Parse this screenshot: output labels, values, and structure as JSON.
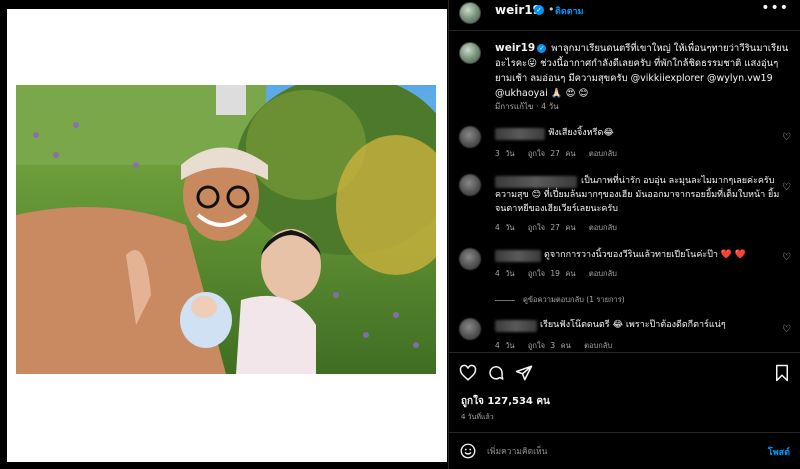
{
  "post": {
    "username": "weir19",
    "follow_label": "ติดตาม",
    "more_label": "•••",
    "verified_mark": "✓",
    "dot": "•"
  },
  "caption": {
    "username": "weir19",
    "text": "พาลูกมาเรียนดนตรีที่เขาใหญ่ ให้เพื่อนๆทายว่าวีรินมาเรียนอะไรคะ😜 ช่วงนี้อากาศกำลังดีเลยครับ ที่พักใกล้ชิดธรรมชาติ แสงอุ่นๆยามเช้า ลมอ่อนๆ มีความสุขครับ @vikkiiexplorer @wylyn.vw19 @ukhaoyai 🙏🏻 😍 😊",
    "meta": "มีการแก้ไข · 4 วัน"
  },
  "comments": [
    {
      "text": "ฟังเสียงจิ้งหรีด😂",
      "time": "3 วัน",
      "likes": "ถูกใจ 27 คน",
      "reply": "ตอบกลับ"
    },
    {
      "text": "เป็นภาพที่น่ารัก อบอุ่น ละมุนละไมมากๆเลยค่ะครับ ความสุข 😊 ที่เปี่ยมล้นมากๆของเฮีย มันออกมาจากรอยยิ้มที่เต็มใบหน้า ยิ้มจนตาหยีของเฮียเวียร์เลยนะครับ",
      "time": "4 วัน",
      "likes": "ถูกใจ 27 คน",
      "reply": "ตอบกลับ"
    },
    {
      "text": "ดูจากการวางนิ้วของวีรินแล้วทายเปียโนค่ะป๊า ❤️ ❤️",
      "time": "4 วัน",
      "likes": "ถูกใจ 19 คน",
      "reply": "ตอบกลับ",
      "view_replies": "ดูข้อความตอบกลับ (1 รายการ)"
    },
    {
      "text": "เรียนฟังโน๊ตดนตรี 😂 เพราะป๊าต้องดีดกีตาร์แน่ๆ",
      "time": "4 วัน",
      "likes": "ถูกใจ 3 คน",
      "reply": "ตอบกลับ"
    }
  ],
  "footer": {
    "likes": "ถูกใจ 127,534 คน",
    "time": "4 วันที่แล้ว",
    "comment_placeholder": "เพิ่มความคิดเห็น",
    "post_label": "โพสต์"
  },
  "icons": {
    "heart": "heart-icon",
    "comment": "comment-icon",
    "share": "share-icon",
    "save": "bookmark-icon",
    "emoji": "emoji-icon"
  },
  "colors": {
    "accent": "#0095f6",
    "background": "#000000",
    "emphasis": "#ed4956"
  }
}
